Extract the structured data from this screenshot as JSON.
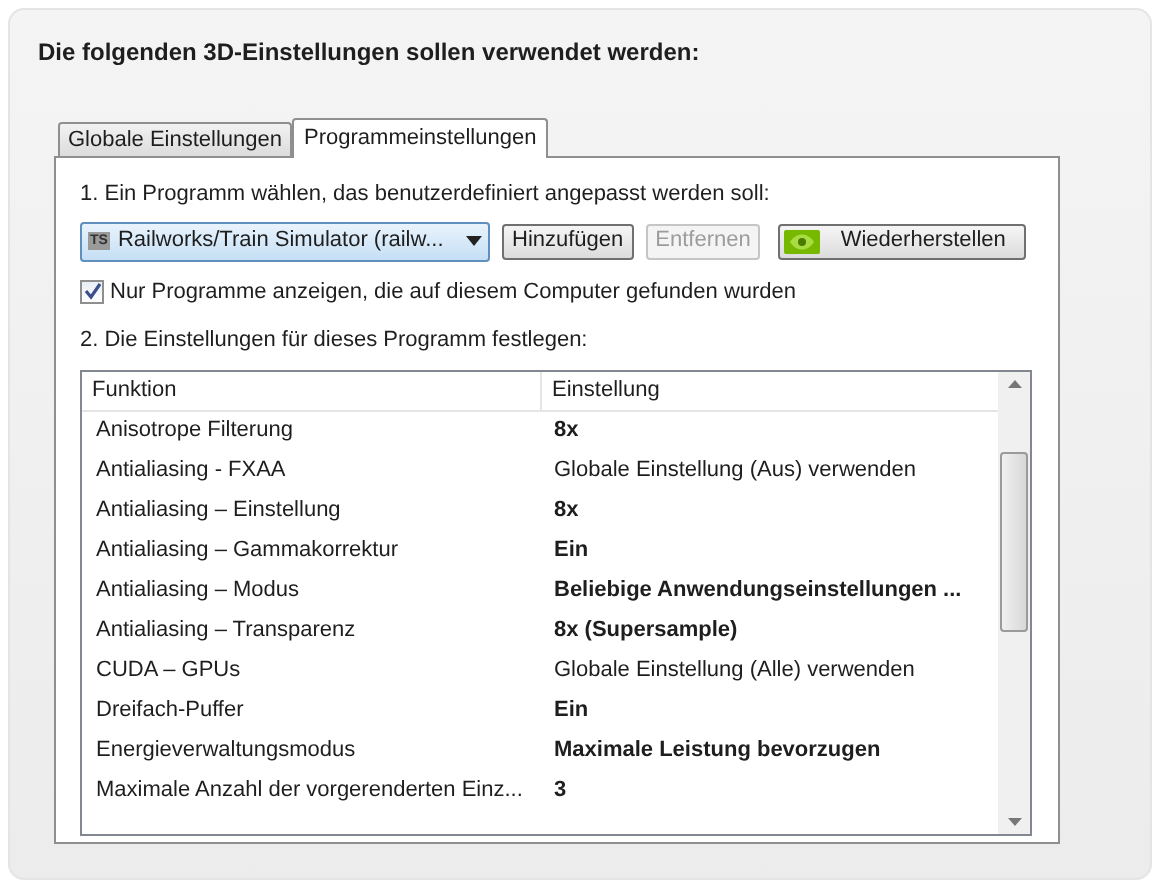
{
  "heading": "Die folgenden 3D-Einstellungen sollen verwendet werden:",
  "tabs": [
    {
      "label": "Globale Einstellungen",
      "selected": false
    },
    {
      "label": "Programmeinstellungen",
      "selected": true
    }
  ],
  "step1": "1. Ein Programm wählen, das benutzerdefiniert angepasst werden soll:",
  "program_select": {
    "badge": "TS",
    "value": "Railworks/Train Simulator (railw..."
  },
  "buttons": [
    {
      "label": "Hinzufügen",
      "disabled": false,
      "kind": "plain"
    },
    {
      "label": "Entfernen",
      "disabled": true,
      "kind": "plain"
    },
    {
      "label": "Wiederherstellen",
      "disabled": false,
      "kind": "logo"
    }
  ],
  "only_found": {
    "label": "Nur Programme anzeigen, die auf diesem Computer gefunden wurden",
    "checked": true
  },
  "step2": "2. Die Einstellungen für dieses Programm festlegen:",
  "table": {
    "columns": [
      "Funktion",
      "Einstellung"
    ],
    "rows": [
      {
        "function": "Anisotrope Filterung",
        "setting": "8x",
        "custom": true
      },
      {
        "function": "Antialiasing - FXAA",
        "setting": "Globale Einstellung (Aus) verwenden",
        "custom": false
      },
      {
        "function": "Antialiasing – Einstellung",
        "setting": "8x",
        "custom": true
      },
      {
        "function": "Antialiasing – Gammakorrektur",
        "setting": "Ein",
        "custom": true
      },
      {
        "function": "Antialiasing – Modus",
        "setting": "Beliebige Anwendungseinstellungen ...",
        "custom": true
      },
      {
        "function": "Antialiasing – Transparenz",
        "setting": "8x (Supersample)",
        "custom": true
      },
      {
        "function": "CUDA – GPUs",
        "setting": "Globale Einstellung (Alle) verwenden",
        "custom": false
      },
      {
        "function": "Dreifach-Puffer",
        "setting": "Ein",
        "custom": true
      },
      {
        "function": "Energieverwaltungsmodus",
        "setting": "Maximale Leistung bevorzugen",
        "custom": true
      },
      {
        "function": "Maximale Anzahl der vorgerenderten Einz...",
        "setting": "3",
        "custom": true
      }
    ]
  }
}
